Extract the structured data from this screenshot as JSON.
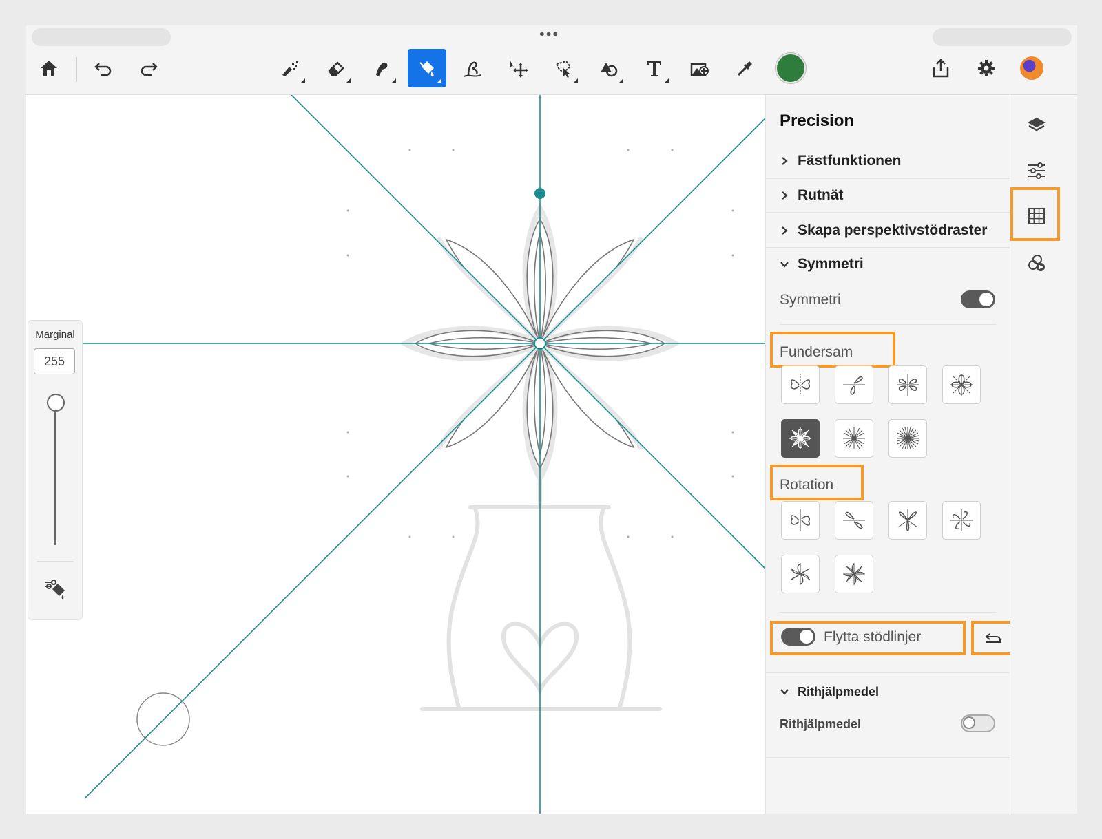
{
  "toolbar": {
    "tools": [
      "home-icon",
      "undo-icon",
      "redo-icon",
      "pixel-brush-icon",
      "eraser-icon",
      "smudge-icon",
      "fill-icon",
      "liquify-icon",
      "transform-icon",
      "lasso-select-icon",
      "shapes-icon",
      "text-icon",
      "add-image-icon",
      "eyedropper-icon",
      "color-swatch",
      "share-icon",
      "settings-icon",
      "avatar"
    ],
    "active_tool": "fill-icon",
    "current_color": "#2e7d3c",
    "active_color": "#1473e6"
  },
  "marginal": {
    "label": "Marginal",
    "value": "255",
    "slider_level": 1.0
  },
  "panel": {
    "title": "Precision",
    "sections": {
      "snapping": "Fästfunktionen",
      "grid": "Rutnät",
      "perspective": "Skapa perspektivstödraster",
      "symmetry": "Symmetri",
      "drawing_aids": "Rithjälpmedel"
    },
    "symmetry_toggle_label": "Symmetri",
    "symmetry_on": true,
    "mirror_label": "Fundersam",
    "rotation_label": "Rotation",
    "move_guides_label": "Flytta stödlinjer",
    "move_guides_on": true,
    "drawing_aids_toggle_label": "Rithjälpmedel",
    "drawing_aids_on": false,
    "selected_mirror_preset": 5
  },
  "rail": {
    "items": [
      "layers-icon",
      "adjustments-icon",
      "grid-icon",
      "timelapse-icon"
    ],
    "highlighted": "grid-icon"
  },
  "colors": {
    "highlight": "#f39a2b",
    "guide_line": "#1a8a8f"
  }
}
